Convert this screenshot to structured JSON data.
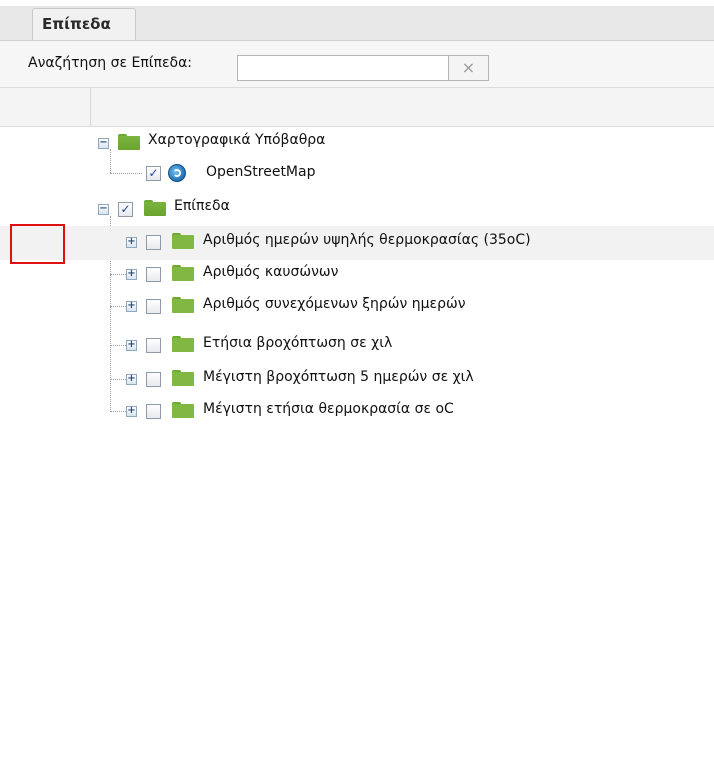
{
  "panel": {
    "tab_label": "Επίπεδα"
  },
  "search": {
    "label": "Αναζήτηση σε Επίπεδα:",
    "value": "",
    "placeholder": "",
    "clear_glyph": "×"
  },
  "tree": {
    "basemaps": {
      "label": "Χαρτογραφικά Υπόβαθρα",
      "children": [
        {
          "label": "OpenStreetMap",
          "checked": true,
          "icon": "openstreetmap-icon"
        }
      ]
    },
    "layers": {
      "label": "Επίπεδα",
      "checked": true,
      "children": [
        {
          "label": "Αριθμός ημερών υψηλής θερμοκρασίας (35oC)",
          "checked": false
        },
        {
          "label": "Αριθμός καυσώνων",
          "checked": false
        },
        {
          "label": "Αριθμός συνεχόμενων ξηρών ημερών",
          "checked": false
        },
        {
          "label": "Ετήσια βροχόπτωση σε χιλ",
          "checked": false
        },
        {
          "label": "Μέγιστη βροχόπτωση 5 ημερών σε χιλ",
          "checked": false
        },
        {
          "label": "Μέγιστη ετήσια θερμοκρασία σε oC",
          "checked": false
        }
      ]
    }
  },
  "colors": {
    "highlight_box": "#e01010",
    "folder_green": "#80b843",
    "checkbox_check": "#24449a"
  }
}
